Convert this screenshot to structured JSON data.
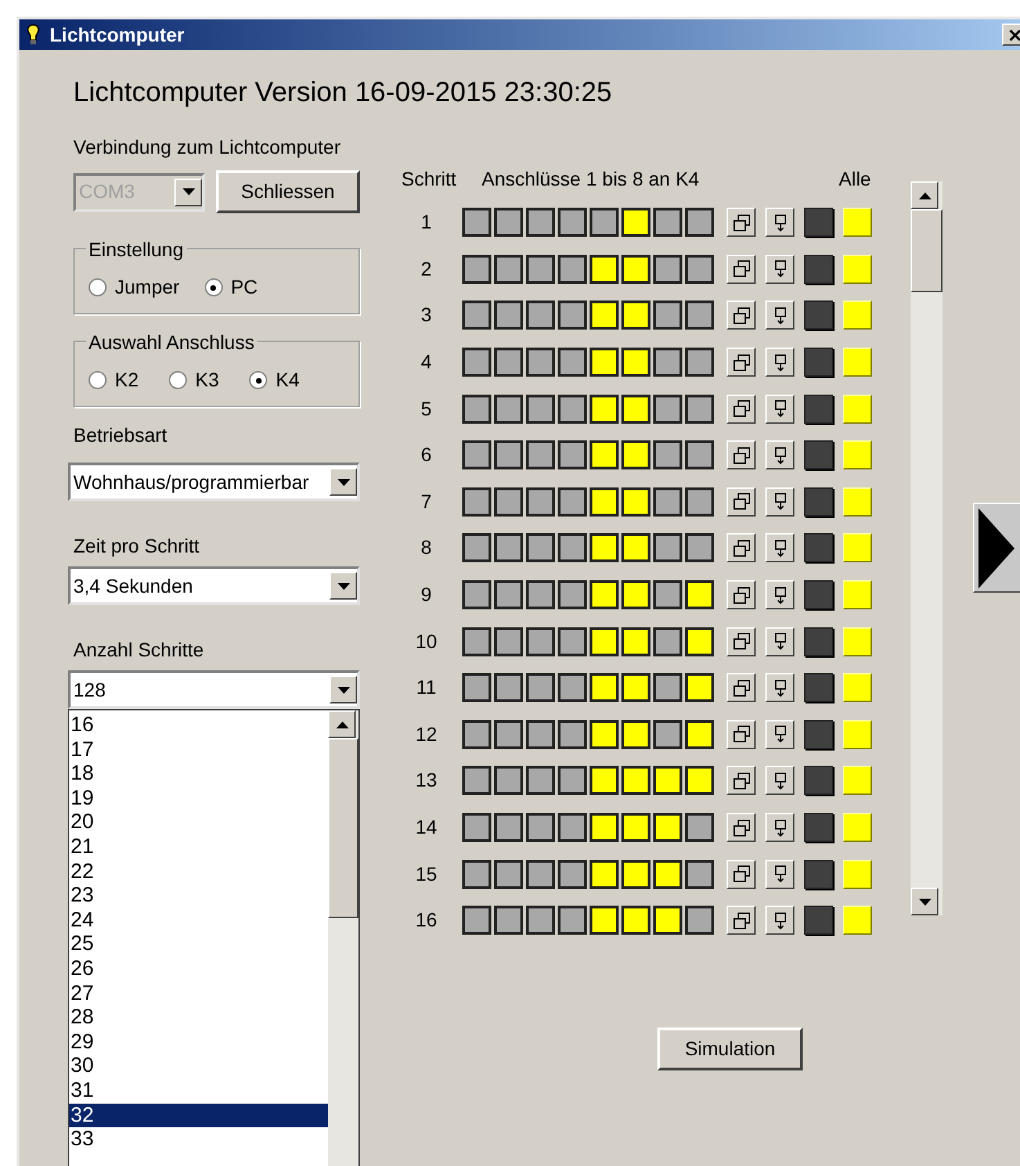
{
  "window": {
    "title": "Lichtcomputer"
  },
  "heading": "Lichtcomputer Version 16-09-2015 23:30:25",
  "connection": {
    "label": "Verbindung zum Lichtcomputer",
    "port": "COM3",
    "disabled": true,
    "button": "Schliessen"
  },
  "settings": {
    "title": "Einstellung",
    "options": [
      {
        "label": "Jumper",
        "selected": false
      },
      {
        "label": "PC",
        "selected": true
      }
    ]
  },
  "port_select": {
    "title": "Auswahl Anschluss",
    "options": [
      {
        "label": "K2",
        "selected": false
      },
      {
        "label": "K3",
        "selected": false
      },
      {
        "label": "K4",
        "selected": true
      }
    ]
  },
  "mode": {
    "label": "Betriebsart",
    "value": "Wohnhaus/programmierbar"
  },
  "time": {
    "label": "Zeit pro Schritt",
    "value": "3,4 Sekunden"
  },
  "steps": {
    "label": "Anzahl Schritte",
    "value": "128",
    "options": [
      {
        "label": "16",
        "selected": false
      },
      {
        "label": "17",
        "selected": false
      },
      {
        "label": "18",
        "selected": false
      },
      {
        "label": "19",
        "selected": false
      },
      {
        "label": "20",
        "selected": false
      },
      {
        "label": "21",
        "selected": false
      },
      {
        "label": "22",
        "selected": false
      },
      {
        "label": "23",
        "selected": false
      },
      {
        "label": "24",
        "selected": false
      },
      {
        "label": "25",
        "selected": false
      },
      {
        "label": "26",
        "selected": false
      },
      {
        "label": "27",
        "selected": false
      },
      {
        "label": "28",
        "selected": false
      },
      {
        "label": "29",
        "selected": false
      },
      {
        "label": "30",
        "selected": false
      },
      {
        "label": "31",
        "selected": false
      },
      {
        "label": "32",
        "selected": true
      },
      {
        "label": "33",
        "selected": false
      }
    ]
  },
  "grid": {
    "step_header": "Schritt",
    "outputs_header": "Anschlüsse 1 bis 8 an K4",
    "all_header": "Alle",
    "rows": [
      {
        "step": "1",
        "outputs": [
          false,
          false,
          false,
          false,
          false,
          true,
          false,
          false
        ]
      },
      {
        "step": "2",
        "outputs": [
          false,
          false,
          false,
          false,
          true,
          true,
          false,
          false
        ]
      },
      {
        "step": "3",
        "outputs": [
          false,
          false,
          false,
          false,
          true,
          true,
          false,
          false
        ]
      },
      {
        "step": "4",
        "outputs": [
          false,
          false,
          false,
          false,
          true,
          true,
          false,
          false
        ]
      },
      {
        "step": "5",
        "outputs": [
          false,
          false,
          false,
          false,
          true,
          true,
          false,
          false
        ]
      },
      {
        "step": "6",
        "outputs": [
          false,
          false,
          false,
          false,
          true,
          true,
          false,
          false
        ]
      },
      {
        "step": "7",
        "outputs": [
          false,
          false,
          false,
          false,
          true,
          true,
          false,
          false
        ]
      },
      {
        "step": "8",
        "outputs": [
          false,
          false,
          false,
          false,
          true,
          true,
          false,
          false
        ]
      },
      {
        "step": "9",
        "outputs": [
          false,
          false,
          false,
          false,
          true,
          true,
          false,
          true
        ]
      },
      {
        "step": "10",
        "outputs": [
          false,
          false,
          false,
          false,
          true,
          true,
          false,
          true
        ]
      },
      {
        "step": "11",
        "outputs": [
          false,
          false,
          false,
          false,
          true,
          true,
          false,
          true
        ]
      },
      {
        "step": "12",
        "outputs": [
          false,
          false,
          false,
          false,
          true,
          true,
          false,
          true
        ]
      },
      {
        "step": "13",
        "outputs": [
          false,
          false,
          false,
          false,
          true,
          true,
          true,
          true
        ]
      },
      {
        "step": "14",
        "outputs": [
          false,
          false,
          false,
          false,
          true,
          true,
          true,
          false
        ]
      },
      {
        "step": "15",
        "outputs": [
          false,
          false,
          false,
          false,
          true,
          true,
          true,
          false
        ]
      },
      {
        "step": "16",
        "outputs": [
          false,
          false,
          false,
          false,
          true,
          true,
          true,
          false
        ]
      }
    ]
  },
  "simulate_button": "Simulation"
}
